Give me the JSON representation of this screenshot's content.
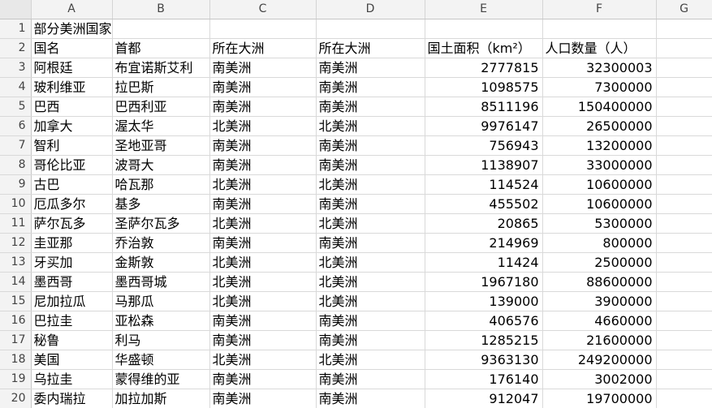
{
  "columns": [
    "A",
    "B",
    "C",
    "D",
    "E",
    "F",
    "G"
  ],
  "title": "部分美洲国家",
  "headers": [
    "国名",
    "首都",
    "所在大洲",
    "所在大洲",
    "国土面积（km²）",
    "人口数量（人）"
  ],
  "rows": [
    {
      "num": "3",
      "cells": [
        "阿根廷",
        "布宜诺斯艾利",
        "南美洲",
        "南美洲",
        "2777815",
        "32300003"
      ]
    },
    {
      "num": "4",
      "cells": [
        "玻利维亚",
        "拉巴斯",
        "南美洲",
        "南美洲",
        "1098575",
        "7300000"
      ]
    },
    {
      "num": "5",
      "cells": [
        "巴西",
        "巴西利亚",
        "南美洲",
        "南美洲",
        "8511196",
        "150400000"
      ]
    },
    {
      "num": "6",
      "cells": [
        "加拿大",
        "渥太华",
        "北美洲",
        "北美洲",
        "9976147",
        "26500000"
      ]
    },
    {
      "num": "7",
      "cells": [
        "智利",
        "圣地亚哥",
        "南美洲",
        "南美洲",
        "756943",
        "13200000"
      ]
    },
    {
      "num": "8",
      "cells": [
        "哥伦比亚",
        "波哥大",
        "南美洲",
        "南美洲",
        "1138907",
        "33000000"
      ]
    },
    {
      "num": "9",
      "cells": [
        "古巴",
        "哈瓦那",
        "北美洲",
        "北美洲",
        "114524",
        "10600000"
      ]
    },
    {
      "num": "10",
      "cells": [
        "厄瓜多尔",
        "基多",
        "南美洲",
        "南美洲",
        "455502",
        "10600000"
      ]
    },
    {
      "num": "11",
      "cells": [
        "萨尔瓦多",
        "圣萨尔瓦多",
        "北美洲",
        "北美洲",
        "20865",
        "5300000"
      ]
    },
    {
      "num": "12",
      "cells": [
        "圭亚那",
        "乔治敦",
        "南美洲",
        "南美洲",
        "214969",
        "800000"
      ]
    },
    {
      "num": "13",
      "cells": [
        "牙买加",
        "金斯敦",
        "北美洲",
        "北美洲",
        "11424",
        "2500000"
      ]
    },
    {
      "num": "14",
      "cells": [
        "墨西哥",
        "墨西哥城",
        "北美洲",
        "北美洲",
        "1967180",
        "88600000"
      ]
    },
    {
      "num": "15",
      "cells": [
        "尼加拉瓜",
        "马那瓜",
        "北美洲",
        "北美洲",
        "139000",
        "3900000"
      ]
    },
    {
      "num": "16",
      "cells": [
        "巴拉圭",
        "亚松森",
        "南美洲",
        "南美洲",
        "406576",
        "4660000"
      ]
    },
    {
      "num": "17",
      "cells": [
        "秘鲁",
        "利马",
        "南美洲",
        "南美洲",
        "1285215",
        "21600000"
      ]
    },
    {
      "num": "18",
      "cells": [
        "美国",
        "华盛顿",
        "北美洲",
        "北美洲",
        "9363130",
        "249200000"
      ]
    },
    {
      "num": "19",
      "cells": [
        "乌拉圭",
        "蒙得维的亚",
        "南美洲",
        "南美洲",
        "176140",
        "3002000"
      ]
    },
    {
      "num": "20",
      "cells": [
        "委内瑞拉",
        "加拉加斯",
        "南美洲",
        "南美洲",
        "912047",
        "19700000"
      ]
    }
  ]
}
